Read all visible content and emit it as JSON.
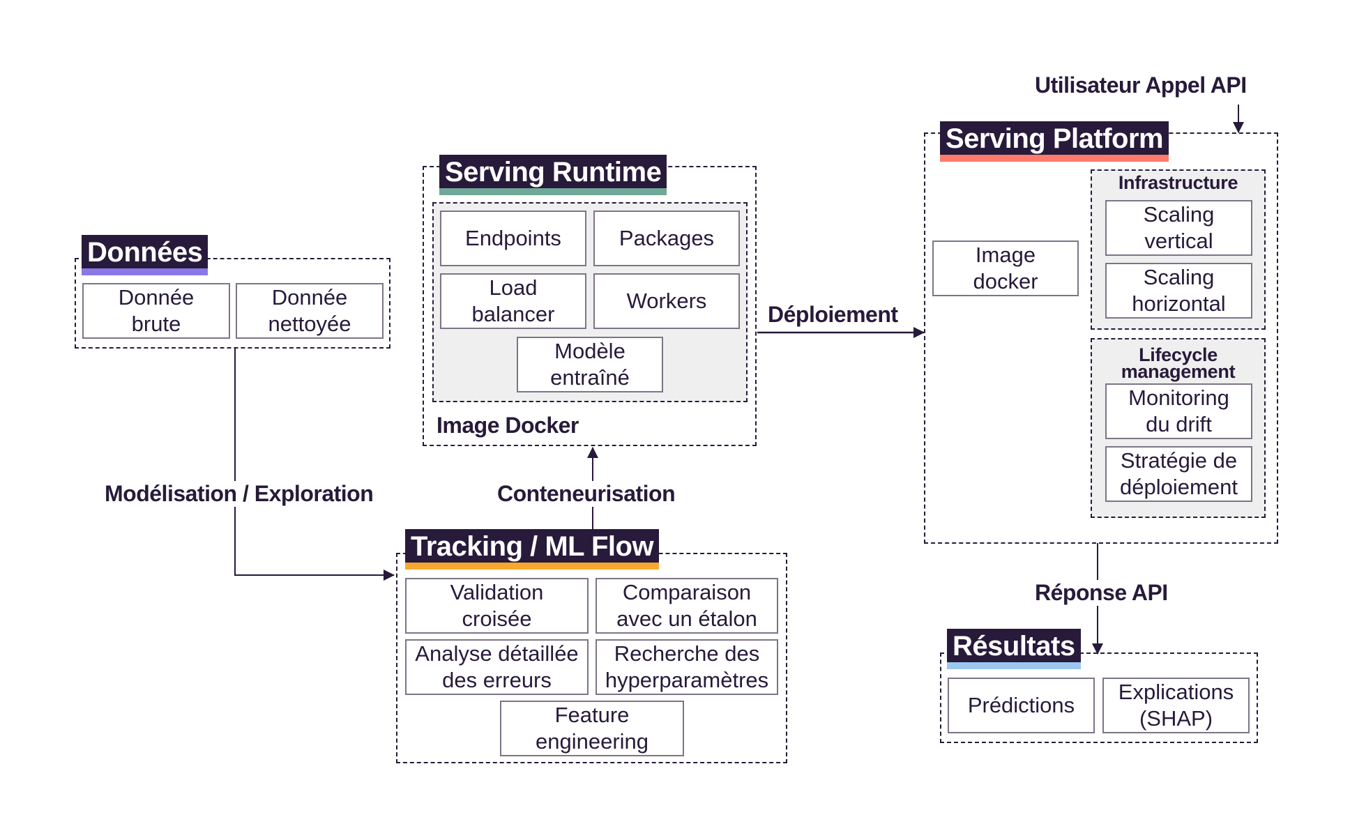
{
  "colors": {
    "ink": "#271a3a",
    "donnees_accent": "#8a78e6",
    "runtime_accent": "#6fa898",
    "platform_accent": "#ff7a6b",
    "tracking_accent": "#f9a82f",
    "resultats_accent": "#9cc8f0",
    "panel_gray": "#efefef"
  },
  "donnees": {
    "title": "Données",
    "items": [
      "Donnée\nbrute",
      "Donnée\nnettoyée"
    ]
  },
  "serving_runtime": {
    "title": "Serving Runtime",
    "items": [
      "Endpoints",
      "Packages",
      "Load\nbalancer",
      "Workers",
      "Modèle\nentraîné"
    ],
    "footer_label": "Image Docker"
  },
  "tracking": {
    "title": "Tracking / ML Flow",
    "items": [
      "Validation\ncroisée",
      "Comparaison\navec un étalon",
      "Analyse détaillée\ndes erreurs",
      "Recherche des\nhyperparamètres",
      "Feature\nengineering"
    ]
  },
  "serving_platform": {
    "title": "Serving Platform",
    "image_box": "Image\ndocker",
    "infrastructure": {
      "label": "Infrastructure",
      "items": [
        "Scaling\nvertical",
        "Scaling\nhorizontal"
      ]
    },
    "lifecycle": {
      "label": "Lifecycle\nmanagement",
      "items": [
        "Monitoring\ndu drift",
        "Stratégie de\ndéploiement"
      ]
    }
  },
  "resultats": {
    "title": "Résultats",
    "items": [
      "Prédictions",
      "Explications\n(SHAP)"
    ]
  },
  "edges": {
    "modelisation": "Modélisation / Exploration",
    "conteneurisation": "Conteneurisation",
    "deploiement": "Déploiement",
    "utilisateur": "Utilisateur Appel API",
    "reponse": "Réponse API"
  }
}
